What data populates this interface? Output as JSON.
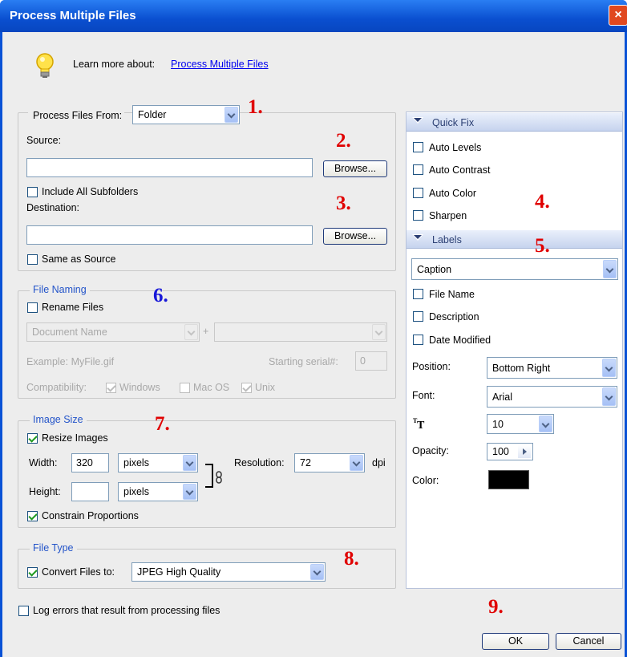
{
  "window": {
    "title": "Process Multiple Files",
    "close_glyph": "×"
  },
  "help": {
    "prefix": "Learn more about: ",
    "link": "Process Multiple Files"
  },
  "source": {
    "process_from_label": "Process Files From:",
    "process_from_value": "Folder",
    "source_label": "Source:",
    "source_value": "",
    "browse_label": "Browse...",
    "include_subfolders_label": "Include All Subfolders",
    "include_subfolders_checked": false,
    "destination_label": "Destination:",
    "destination_value": "",
    "browse2_label": "Browse...",
    "same_as_source_label": "Same as Source",
    "same_as_source_checked": false
  },
  "file_naming": {
    "legend": "File Naming",
    "rename_label": "Rename Files",
    "rename_checked": false,
    "name_select": "Document Name",
    "plus": "+",
    "second_select": "",
    "example": "Example: MyFile.gif",
    "serial_label": "Starting serial#:",
    "serial_value": "0",
    "compat_label": "Compatibility:",
    "windows_label": "Windows",
    "macos_label": "Mac OS",
    "unix_label": "Unix"
  },
  "image_size": {
    "legend": "Image Size",
    "resize_label": "Resize Images",
    "resize_checked": true,
    "width_label": "Width:",
    "width_value": "320",
    "width_unit": "pixels",
    "height_label": "Height:",
    "height_value": "",
    "height_unit": "pixels",
    "resolution_label": "Resolution:",
    "resolution_value": "72",
    "dpi_label": "dpi",
    "constrain_label": "Constrain Proportions",
    "constrain_checked": true
  },
  "file_type": {
    "legend": "File Type",
    "convert_label": "Convert Files to:",
    "convert_checked": true,
    "convert_value": "JPEG High Quality"
  },
  "log": {
    "label": "Log errors that result from processing files",
    "checked": false
  },
  "quick_fix": {
    "title": "Quick Fix",
    "items": [
      "Auto Levels",
      "Auto Contrast",
      "Auto Color",
      "Sharpen"
    ]
  },
  "labels": {
    "title": "Labels",
    "type_value": "Caption",
    "items": [
      "File Name",
      "Description",
      "Date Modified"
    ],
    "position_label": "Position:",
    "position_value": "Bottom Right",
    "font_label": "Font:",
    "font_value": "Arial",
    "size_value": "10",
    "opacity_label": "Opacity:",
    "opacity_value": "100",
    "color_label": "Color:",
    "color_swatch": "#000000"
  },
  "buttons": {
    "ok": "OK",
    "cancel": "Cancel"
  },
  "annotations": [
    "1.",
    "2.",
    "3.",
    "4.",
    "5.",
    "6.",
    "7.",
    "8.",
    "9."
  ],
  "colors": {
    "title_bar": "#0a4fd0",
    "annotation_red": "#e00000",
    "annotation_blue": "#1818d8",
    "legend_text": "#2354c9"
  }
}
